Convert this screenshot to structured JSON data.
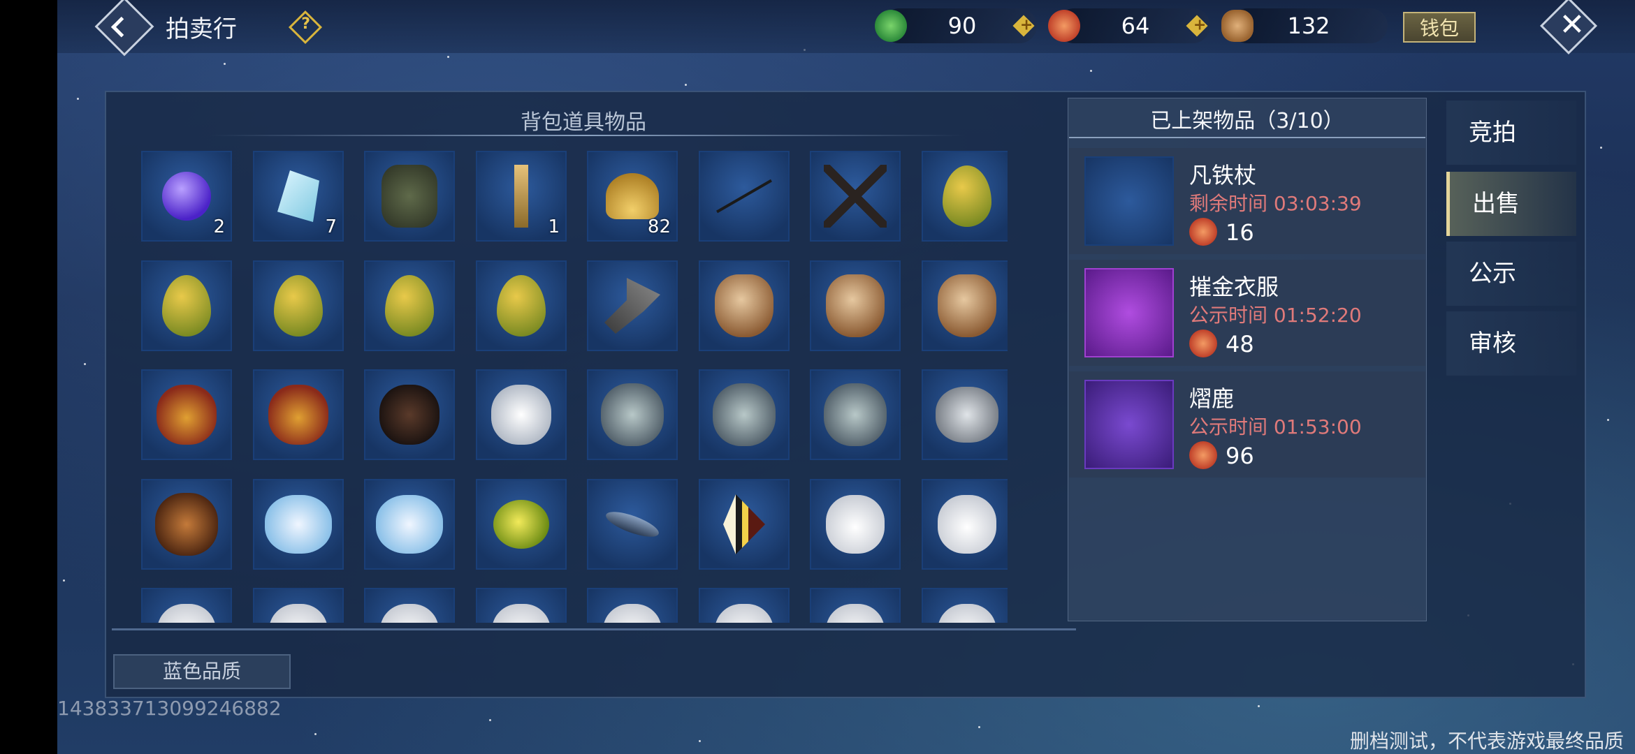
{
  "header": {
    "title": "拍卖行",
    "help_symbol": "?",
    "wallet_label": "钱包",
    "close_symbol": "✕"
  },
  "currencies": [
    {
      "icon": "jade-coin-icon",
      "value": "90",
      "color": "#3fae4a"
    },
    {
      "icon": "red-coin-icon",
      "value": "64",
      "color": "#d2503a"
    },
    {
      "icon": "seed-coin-icon",
      "value": "132",
      "color": "#c08a4a"
    }
  ],
  "inventory": {
    "header": "背包道具物品",
    "quality_filter": "蓝色品质",
    "items": [
      {
        "icon": "purple-orb-icon",
        "count": "2"
      },
      {
        "icon": "crystal-icon",
        "count": "7"
      },
      {
        "icon": "armor-icon",
        "count": ""
      },
      {
        "icon": "lantern-staff-icon",
        "count": "1"
      },
      {
        "icon": "shell-icon",
        "count": "82"
      },
      {
        "icon": "whip-icon",
        "count": ""
      },
      {
        "icon": "twin-blades-icon",
        "count": ""
      },
      {
        "icon": "egg-icon",
        "count": ""
      },
      {
        "icon": "egg-icon",
        "count": ""
      },
      {
        "icon": "egg-icon",
        "count": ""
      },
      {
        "icon": "egg-icon",
        "count": ""
      },
      {
        "icon": "egg-icon",
        "count": ""
      },
      {
        "icon": "hammer-icon",
        "count": ""
      },
      {
        "icon": "camel-head-icon",
        "count": ""
      },
      {
        "icon": "camel-head-icon",
        "count": ""
      },
      {
        "icon": "camel-head-icon",
        "count": ""
      },
      {
        "icon": "griffin-head-icon",
        "count": ""
      },
      {
        "icon": "griffin-head-icon",
        "count": ""
      },
      {
        "icon": "wolf-head-icon",
        "count": ""
      },
      {
        "icon": "white-wolf-head-icon",
        "count": ""
      },
      {
        "icon": "elephant-head-icon",
        "count": ""
      },
      {
        "icon": "elephant-head-icon",
        "count": ""
      },
      {
        "icon": "elephant-head-icon",
        "count": ""
      },
      {
        "icon": "grey-griffin-head-icon",
        "count": ""
      },
      {
        "icon": "yak-head-icon",
        "count": ""
      },
      {
        "icon": "white-beast-head-icon",
        "count": ""
      },
      {
        "icon": "white-beast-head-icon",
        "count": ""
      },
      {
        "icon": "pufferfish-icon",
        "count": ""
      },
      {
        "icon": "shark-icon",
        "count": ""
      },
      {
        "icon": "angelfish-icon",
        "count": ""
      },
      {
        "icon": "white-eagle-head-icon",
        "count": ""
      },
      {
        "icon": "white-eagle-head-icon",
        "count": ""
      },
      {
        "icon": "white-eagle-head-icon",
        "count": ""
      },
      {
        "icon": "white-eagle-head-icon",
        "count": ""
      },
      {
        "icon": "white-eagle-head-icon",
        "count": ""
      },
      {
        "icon": "white-eagle-head-icon",
        "count": ""
      },
      {
        "icon": "white-eagle-head-icon",
        "count": ""
      },
      {
        "icon": "white-eagle-head-icon",
        "count": ""
      },
      {
        "icon": "white-eagle-head-icon",
        "count": ""
      },
      {
        "icon": "white-eagle-head-icon",
        "count": ""
      }
    ]
  },
  "listed": {
    "header": "已上架物品（3/10）",
    "entries": [
      {
        "name": "凡铁杖",
        "time": "剩余时间 03:03:39",
        "price": "16",
        "icon": "iron-staff-icon",
        "bg": "#1f3f73"
      },
      {
        "name": "摧金衣服",
        "time": "公示时间 01:52:20",
        "price": "48",
        "icon": "golden-robe-icon",
        "bg": "#7a1fa3"
      },
      {
        "name": "熠鹿",
        "time": "公示时间 01:53:00",
        "price": "96",
        "icon": "deer-head-icon",
        "bg": "#4a2a8a"
      }
    ]
  },
  "tabs": [
    {
      "label": "竞拍",
      "active": false
    },
    {
      "label": "出售",
      "active": true
    },
    {
      "label": "公示",
      "active": false
    },
    {
      "label": "审核",
      "active": false
    }
  ],
  "footer": {
    "uid": "14383371309924688​2",
    "disclaimer": "删档测试，不代表游戏最终品质"
  }
}
